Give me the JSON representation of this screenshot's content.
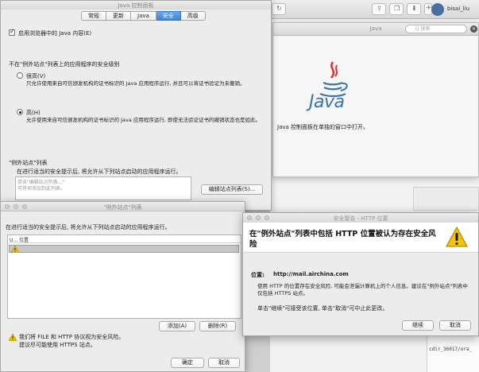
{
  "background": {
    "user_name": "bisai_liu",
    "terminal_text": "cdir_36017/ora_"
  },
  "about_window": {
    "title": "Java",
    "search_placeholder": "Q 搜索",
    "logo_text": "Java",
    "message": "Java 控制面板在单独的窗口中打开。"
  },
  "control_panel": {
    "title": "Java 控制面板",
    "tabs": [
      {
        "label": "常规",
        "active": false
      },
      {
        "label": "更新",
        "active": false
      },
      {
        "label": "Java",
        "active": false
      },
      {
        "label": "安全",
        "active": true
      },
      {
        "label": "高级",
        "active": false
      }
    ],
    "enable_java_label": "启用浏览器中的 Java 内容(E)",
    "enable_java_checked": true,
    "security_level_heading": "不在\"例外站点\"列表上的应用程序的安全级别",
    "level_very_high": {
      "label": "很高(V)",
      "selected": false,
      "description": "只允许使用来自可信颁发机构的证书标识的 Java 应用程序运行, 并且可以将证书验证为未撤销。"
    },
    "level_high": {
      "label": "高(H)",
      "selected": true,
      "description": "允许使用来自可信颁发机构的证书标识的 Java 应用程序运行, 即使无法验证证书的撤销状态也是如此。"
    },
    "exception_heading": "\"例外站点\"列表",
    "exception_desc": "在进行适当的安全提示后, 将允许从下列站点启动的应用程序运行。",
    "exception_placeholder_1": "单击\"编辑站点列表...\"",
    "exception_placeholder_2": "可将项添加到此列表。",
    "edit_site_list_button": "编辑站点列表(S)..."
  },
  "exception_dialog": {
    "title": "\"例外站点\"列表",
    "description": "在进行适当的安全提示后, 将允许从下列站点启动的应用程序运行。",
    "column_header": "U... 位置",
    "add_button": "添加(A)",
    "remove_button": "删除(R)",
    "warning_line_1": "我们将 FILE 和 HTTP 协议视为安全风险。",
    "warning_line_2": "建议尽可能使用 HTTPS 站点。",
    "ok_button": "确定",
    "cancel_button": "取消"
  },
  "security_alert": {
    "title": "安全警告 - HTTP 位置",
    "heading": "在\"例外站点\"列表中包括 HTTP 位置被认为存在安全风险",
    "location_label": "位置:",
    "location_value": "http://mail.airchina.com",
    "body_text": "使用 HTTP 的位置存在安全风险, 可能会泄漏计算机上的个人信息。建议在\"例外站点\"列表中仅包括 HTTPS 站点。",
    "hint_text": "单击\"继续\"可接受该位置, 单击\"取消\"可中止此更改。",
    "continue_button": "继续",
    "cancel_button": "取消"
  }
}
